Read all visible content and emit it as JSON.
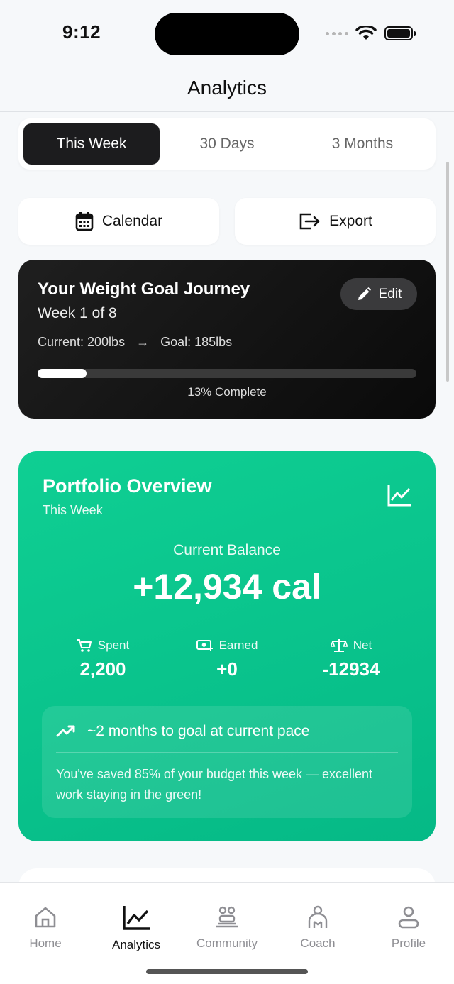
{
  "status": {
    "time": "9:12"
  },
  "nav": {
    "title": "Analytics"
  },
  "segments": [
    {
      "label": "This Week",
      "active": true
    },
    {
      "label": "30 Days",
      "active": false
    },
    {
      "label": "3 Months",
      "active": false
    }
  ],
  "actions": {
    "calendar_label": "Calendar",
    "calendar_icon": "calendar-icon",
    "export_label": "Export",
    "export_icon": "export-icon"
  },
  "goal": {
    "title": "Your Weight Goal Journey",
    "week": "Week 1 of 8",
    "current": "Current: 200lbs",
    "arrow": "→",
    "target": "Goal: 185lbs",
    "edit_label": "Edit",
    "progress_fraction": 0.13,
    "progress_label": "13% Complete"
  },
  "portfolio": {
    "title": "Portfolio Overview",
    "subtitle": "This Week",
    "balance_label": "Current Balance",
    "balance_value": "+12,934 cal",
    "stats": [
      {
        "label": "Spent",
        "value": "2,200",
        "icon": "cart-icon"
      },
      {
        "label": "Earned",
        "value": "+0",
        "icon": "money-icon"
      },
      {
        "label": "Net",
        "value": "-12934",
        "icon": "scale-icon"
      }
    ],
    "insight_headline": "~2 months to goal at current pace",
    "insight_text": "You've saved 85% of your budget this week — excellent work staying in the green!",
    "accent_color": "#0fcf93"
  },
  "tabs": [
    {
      "label": "Home",
      "icon": "home-icon",
      "active": false
    },
    {
      "label": "Analytics",
      "icon": "chart-icon",
      "active": true
    },
    {
      "label": "Community",
      "icon": "community-icon",
      "active": false
    },
    {
      "label": "Coach",
      "icon": "coach-icon",
      "active": false
    },
    {
      "label": "Profile",
      "icon": "profile-icon",
      "active": false
    }
  ]
}
